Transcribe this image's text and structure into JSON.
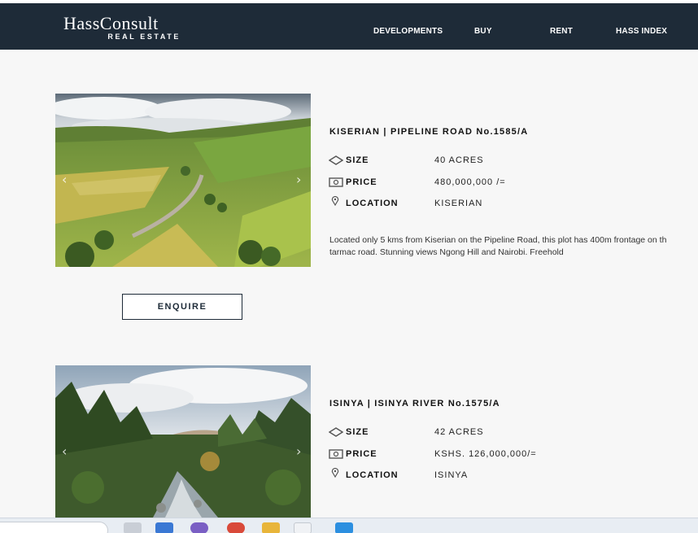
{
  "nav": {
    "logo_main": "HassConsult",
    "logo_sub": "REAL ESTATE",
    "items": [
      "DEVELOPMENTS",
      "BUY",
      "RENT",
      "HASS INDEX"
    ]
  },
  "listings": [
    {
      "title": "KISERIAN | PIPELINE ROAD No.1585/A",
      "size_label": "SIZE",
      "size_value": "40 ACRES",
      "price_label": "PRICE",
      "price_value": "480,000,000 /=",
      "location_label": "LOCATION",
      "location_value": "KISERIAN",
      "description_line1": "Located only 5 kms from Kiserian on the Pipeline Road, this plot has 400m frontage on th",
      "description_line2": "tarmac road. Stunning views Ngong Hill and Nairobi. Freehold",
      "enquire_label": "ENQUIRE"
    },
    {
      "title": "ISINYA | ISINYA RIVER No.1575/A",
      "size_label": "SIZE",
      "size_value": "42 ACRES",
      "price_label": "PRICE",
      "price_value": "KSHS. 126,000,000/=",
      "location_label": "LOCATION",
      "location_value": "ISINYA"
    }
  ],
  "icons": {
    "size": "land-size-icon",
    "price": "banknote-icon",
    "location": "map-pin-icon",
    "prev": "chevron-left-icon",
    "next": "chevron-right-icon"
  },
  "colors": {
    "navbar": "#1e2b38",
    "background": "#f7f7f7",
    "text": "#111111"
  }
}
